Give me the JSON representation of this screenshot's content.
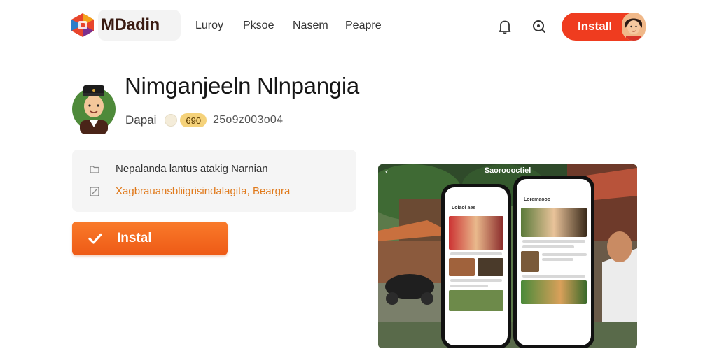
{
  "header": {
    "brand": "MDadin",
    "nav": [
      "Luroy",
      "Pksoe",
      "Nasem",
      "Peapre"
    ],
    "install_label": "Install",
    "icons": [
      "bell-icon",
      "search-icon"
    ]
  },
  "app": {
    "title": "Nimganjeeln Nlnpangia",
    "meta_label": "Dapai",
    "badge": "690",
    "date": "25o9z003o04"
  },
  "info": {
    "line1": "Nepalanda lantus atakig Narnian",
    "line2": "Xagbrauansbliigrisindalagita, Beargra"
  },
  "primary_button": {
    "label": "Instal"
  },
  "screenshot": {
    "title": "Saoroooctiel",
    "phone_left": {
      "header": "Lolaol aee"
    },
    "phone_right": {
      "header": "Loremaooo"
    }
  },
  "colors": {
    "accent": "#ef3c1f",
    "button": "#f06a20",
    "link_text": "#e07a1c"
  }
}
